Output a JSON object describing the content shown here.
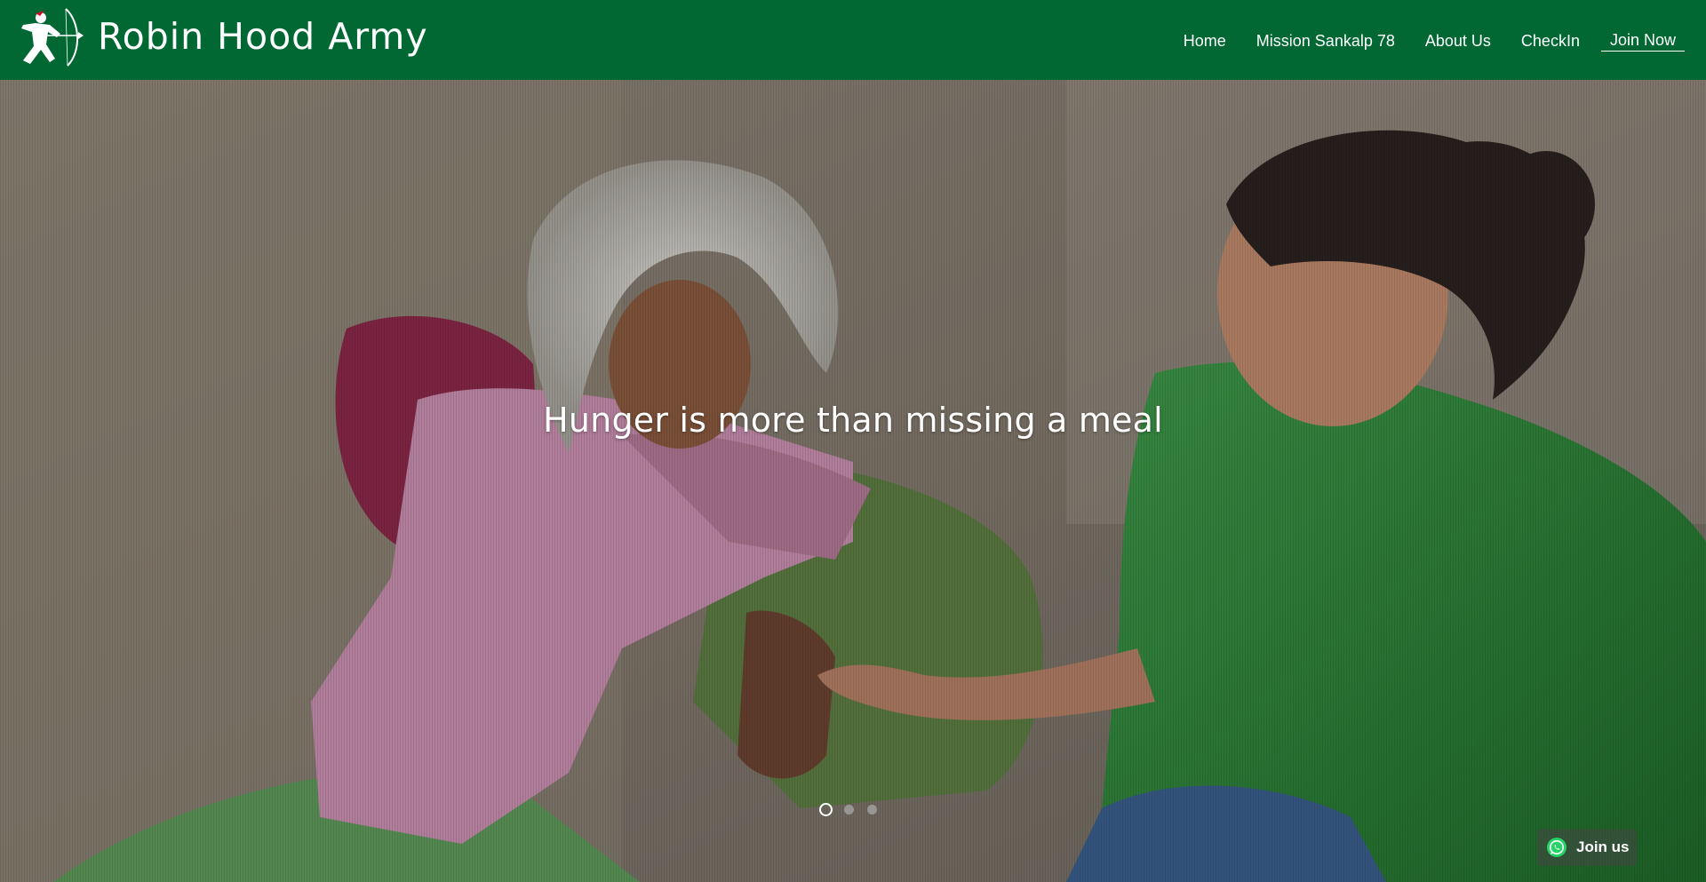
{
  "brand": {
    "name": "Robin Hood Army",
    "logo_icon": "archer-logo-icon",
    "color": "#016833"
  },
  "nav": {
    "items": [
      {
        "label": "Home"
      },
      {
        "label": "Mission Sankalp 78"
      },
      {
        "label": "About Us"
      },
      {
        "label": "CheckIn"
      },
      {
        "label": "Join Now"
      }
    ]
  },
  "hero": {
    "tagline": "Hunger is more than missing a meal",
    "slides_total": 3,
    "active_slide": 1
  },
  "whatsapp": {
    "label": "Join us",
    "icon": "whatsapp-icon",
    "color": "#25d366"
  }
}
